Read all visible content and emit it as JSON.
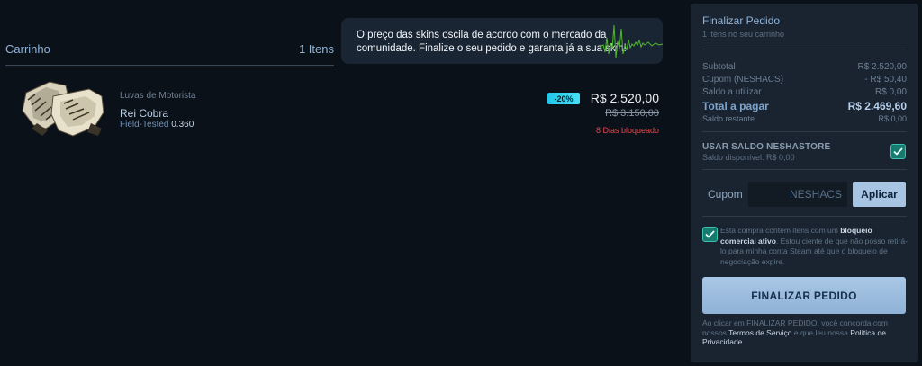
{
  "cart": {
    "title": "Carrinho",
    "count": "1 Itens"
  },
  "banner": {
    "text": "O preço das skins oscila de acordo com o mercado da comunidade. Finalize o seu pedido e garanta já a sua skin!",
    "accent": "#5fd13a"
  },
  "item": {
    "category": "Luvas de Motorista",
    "name": "Rei Cobra",
    "wear": "Field-Tested",
    "float": "0.360",
    "discount": "-20%",
    "price": "R$ 2.520,00",
    "old_price": "R$ 3.150,00",
    "lock_text": "8 Dias bloqueado"
  },
  "summary": {
    "title": "Finalizar Pedido",
    "subtitle": "1 itens no seu carrinho",
    "rows": [
      {
        "label": "Subtotal",
        "value": "R$ 2.520,00"
      },
      {
        "label": "Cupom (NESHACS)",
        "value": "- R$ 50,40"
      },
      {
        "label": "Saldo a utilizar",
        "value": "R$ 0,00"
      }
    ],
    "total_label": "Total a pagar",
    "total_value": "R$ 2.469,60",
    "remaining_label": "Saldo restante",
    "remaining_value": "R$ 0,00",
    "balance_label": "USAR SALDO NESHASTORE",
    "balance_sub": "Saldo disponível: R$ 0,00",
    "coupon_label": "Cupom",
    "coupon_value": "NESHACS",
    "apply_label": "Aplicar",
    "terms_pre": "Esta compra contém itens com um ",
    "terms_bold": "bloqueio comercial ativo",
    "terms_post": ". Estou ciente de que não posso retirá-lo para minha conta Steam até que o bloqueio de negociação expire.",
    "final_button": "FINALIZAR PEDIDO",
    "legal_pre": "Ao clicar em FINALIZAR PEDIDO, você concorda com nossos ",
    "legal_link1": "Termos de Serviço",
    "legal_mid": " e que leu nossa ",
    "legal_link2": "Política de Privacidade"
  }
}
